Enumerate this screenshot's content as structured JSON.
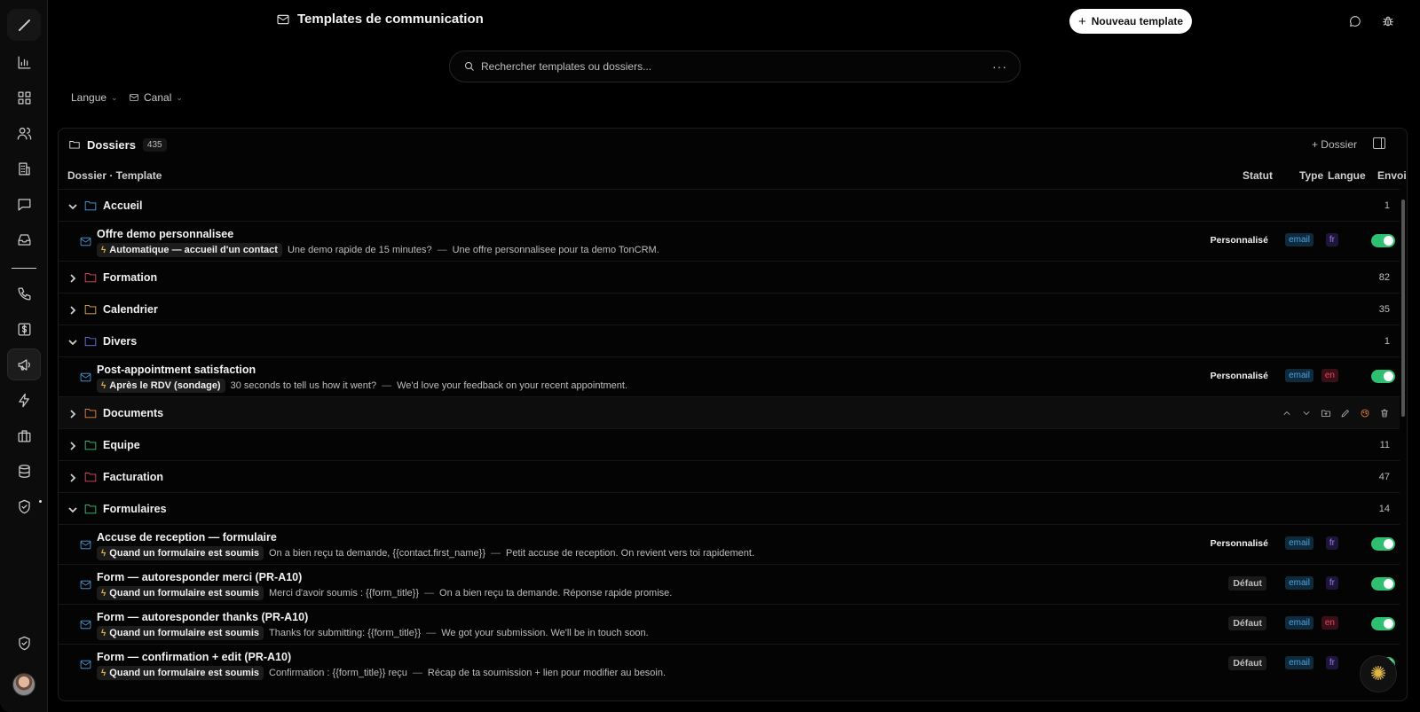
{
  "header": {
    "title": "Templates de communication",
    "new_button": "Nouveau template",
    "plus": "+"
  },
  "search": {
    "placeholder": "Rechercher templates ou dossiers...",
    "more": "···"
  },
  "filters": {
    "langue": "Langue",
    "canal": "Canal",
    "chevron": "⌄"
  },
  "panel": {
    "title": "Dossiers",
    "count": "435",
    "add_folder": "+ Dossier"
  },
  "columns": {
    "template": "Dossier · Template",
    "status": "Statut",
    "type": "Type",
    "lang": "Langue",
    "send": "Envoi"
  },
  "sidebar": {
    "items": [
      "logo-icon",
      "chart-icon",
      "grid-icon",
      "users-icon",
      "building-icon",
      "chat-icon",
      "inbox-icon",
      "phone-icon",
      "dollar-icon",
      "megaphone-icon",
      "bolt-icon",
      "briefcase-icon",
      "database-icon",
      "shield-check-icon",
      "shield-icon"
    ],
    "active": "megaphone-icon"
  },
  "rows": [
    {
      "kind": "folder",
      "name": "Accueil",
      "count": "1",
      "expanded": true,
      "color": "#4aa3e6"
    },
    {
      "kind": "template",
      "name": "Offre demo personnalisee",
      "trigger": "Automatique — accueil d'un contact",
      "subject": "Une demo rapide de 15 minutes?",
      "dash": "—",
      "preview": "Une offre personnalisee pour ta demo TonCRM.",
      "status": "Personnalisé",
      "type": "email",
      "lang": "fr"
    },
    {
      "kind": "folder",
      "name": "Formation",
      "count": "82",
      "expanded": false,
      "color": "#e4485e"
    },
    {
      "kind": "folder",
      "name": "Calendrier",
      "count": "35",
      "expanded": false,
      "color": "#e6b24a"
    },
    {
      "kind": "folder",
      "name": "Divers",
      "count": "1",
      "expanded": true,
      "color": "#6b7bf0"
    },
    {
      "kind": "template",
      "name": "Post-appointment satisfaction",
      "trigger": "Après le RDV (sondage)",
      "subject": "30 seconds to tell us how it went?",
      "dash": "—",
      "preview": "We'd love your feedback on your recent appointment.",
      "status": "Personnalisé",
      "type": "email",
      "lang": "en"
    },
    {
      "kind": "folder",
      "name": "Documents",
      "count": "",
      "expanded": false,
      "color": "#f0883e",
      "hover": true
    },
    {
      "kind": "folder",
      "name": "Equipe",
      "count": "11",
      "expanded": false,
      "color": "#3fbf7f"
    },
    {
      "kind": "folder",
      "name": "Facturation",
      "count": "47",
      "expanded": false,
      "color": "#e4485e"
    },
    {
      "kind": "folder",
      "name": "Formulaires",
      "count": "14",
      "expanded": true,
      "color": "#3fbf7f"
    },
    {
      "kind": "template",
      "name": "Accuse de reception — formulaire",
      "trigger": "Quand un formulaire est soumis",
      "subject": "On a bien reçu ta demande, {{contact.first_name}}",
      "dash": "—",
      "preview": "Petit accuse de reception. On revient vers toi rapidement.",
      "status": "Personnalisé",
      "type": "email",
      "lang": "fr"
    },
    {
      "kind": "template",
      "name": "Form — autoresponder merci (PR-A10)",
      "trigger": "Quand un formulaire est soumis",
      "subject": "Merci d'avoir soumis : {{form_title}}",
      "dash": "—",
      "preview": "On a bien reçu ta demande. Réponse rapide promise.",
      "status": "Défaut",
      "type": "email",
      "lang": "fr"
    },
    {
      "kind": "template",
      "name": "Form — autoresponder thanks (PR-A10)",
      "trigger": "Quand un formulaire est soumis",
      "subject": "Thanks for submitting: {{form_title}}",
      "dash": "—",
      "preview": "We got your submission. We'll be in touch soon.",
      "status": "Défaut",
      "type": "email",
      "lang": "en"
    },
    {
      "kind": "template",
      "name": "Form — confirmation + edit (PR-A10)",
      "trigger": "Quand un formulaire est soumis",
      "subject": "Confirmation : {{form_title}} reçu",
      "dash": "—",
      "preview": "Récap de ta soumission + lien pour modifier au besoin.",
      "status": "Défaut",
      "type": "email",
      "lang": "fr"
    }
  ]
}
